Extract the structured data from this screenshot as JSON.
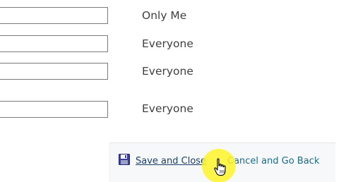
{
  "rows": [
    {
      "field_value": "",
      "visibility": "Only Me"
    },
    {
      "field_value": "",
      "visibility": "Everyone"
    },
    {
      "field_value": "",
      "visibility": "Everyone"
    },
    {
      "field_value": "",
      "visibility": "Everyone"
    }
  ],
  "footer": {
    "save_icon": "floppy-disk-icon",
    "save_label": "Save and Close",
    "cancel_label": "Cancel and Go Back"
  },
  "pointer": {
    "icon": "hand-pointer-icon",
    "highlight_color": "#fff428"
  }
}
